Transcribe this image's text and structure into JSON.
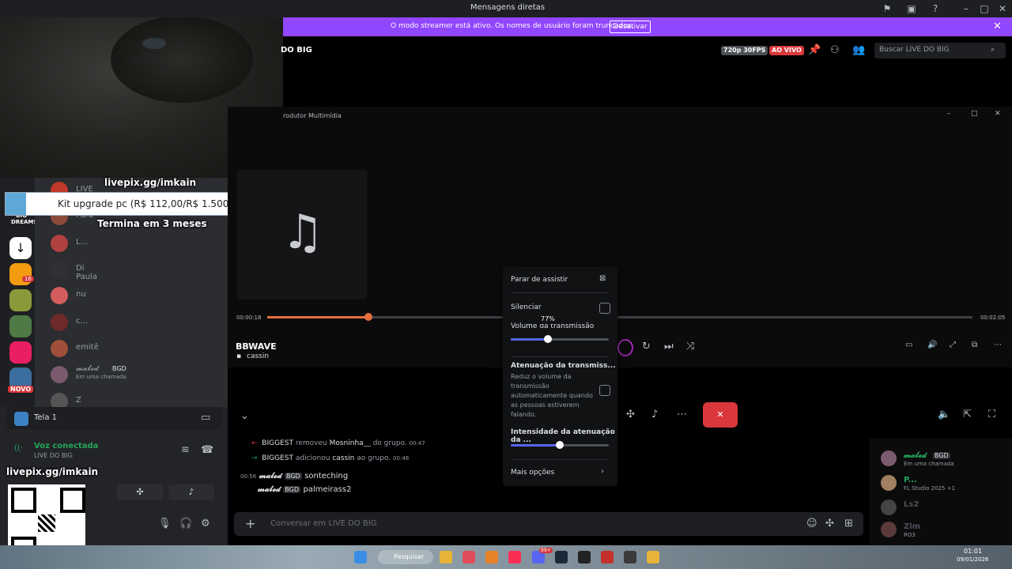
{
  "window": {
    "title": "Mensagens diretas"
  },
  "banner": {
    "message": "O modo streamer está ativo. Os nomes de usuário foram truncados.",
    "button": "Desativar"
  },
  "header": {
    "channel": "DO BIG",
    "quality": "720p 30FPS",
    "live": "AO VIVO",
    "search_placeholder": "Buscar LIVE DO BIG"
  },
  "player": {
    "window_title": "rodutor Multimídia",
    "time_current": "00:00:18",
    "time_total": "00:02:05",
    "progress": 0.144,
    "track": "BBWAVE",
    "user": "cassin"
  },
  "overlay": {
    "livepix_top": "livepix.gg/imkain",
    "kit": "Kit upgrade pc (R$ 112,00/R$ 1.500,00)",
    "ends": "Termina em 3 meses",
    "livepix_bottom": "livepix.gg/imkain"
  },
  "rail": {
    "new_badge": "NOVO",
    "badge_count": "16",
    "big_label": "BIG DREAMS"
  },
  "members_left": [
    {
      "name": "LIVE DO BIG",
      "color": "#c0392b"
    },
    {
      "name": "Para",
      "color": "#8b4a3a"
    },
    {
      "name": "L...",
      "color": "#b0413e"
    },
    {
      "name": "Di Paula",
      "color": "#2f3136"
    },
    {
      "name": "nu",
      "color": "#d35d5d"
    },
    {
      "name": "c...",
      "color": "#6e2a2a"
    },
    {
      "name": "emitê",
      "color": "#a0503a"
    },
    {
      "name": "𝓶𝓪𝓵𝓮𝓭",
      "tag": "BGD",
      "status": "Em uma chamada",
      "color": "#7a5a6e"
    },
    {
      "name": "Z",
      "color": "#555"
    }
  ],
  "voice": {
    "screen": "Tela 1",
    "status": "Voz conectada",
    "channel": "LIVE DO BIG"
  },
  "popup": {
    "stop": "Parar de assistir",
    "mute": "Silenciar",
    "volume_label": "Volume da transmissão",
    "volume_value": "77%",
    "volume": 0.38,
    "attenuation": "Atenuação da transmiss...",
    "attenuation_desc": "Reduz o volume da transmissão automaticamente quando as pessoas estiverem falando.",
    "intensity": "Intensidade da atenuação da ...",
    "intensity_value": 0.5,
    "more": "Mais opções"
  },
  "chat": {
    "events": [
      {
        "actor": "BIGGEST",
        "action": "removeu",
        "target": "Mosninha__",
        "suffix": "do grupo.",
        "time": "00:47",
        "kind": "remove"
      },
      {
        "actor": "BIGGEST",
        "action": "adicionou",
        "target": "cassin",
        "suffix": "ao grupo.",
        "time": "00:48",
        "kind": "add"
      }
    ],
    "messages": [
      {
        "time": "00:56",
        "user": "𝓶𝓪𝓵𝓮𝓭",
        "tag": "BGD",
        "text": "sonteching"
      },
      {
        "time": "",
        "user": "𝓶𝓪𝓵𝓮𝓭",
        "tag": "BGD",
        "text": "palmeirass2"
      }
    ],
    "composer_placeholder": "Conversar em LIVE DO BIG"
  },
  "members_right": [
    {
      "name": "𝓶𝓪𝓵𝓮𝓭",
      "tag": "BGD",
      "status": "Em uma chamada"
    },
    {
      "name": "P...",
      "status": "FL Studio 2025 +1"
    },
    {
      "name": "Ls2",
      "status": ""
    },
    {
      "name": "Zlm",
      "status": "RO3"
    }
  ],
  "taskbar": {
    "search": "Pesquisar",
    "time": "01:01",
    "date": "09/01/2026",
    "discord_badge": "99+"
  }
}
